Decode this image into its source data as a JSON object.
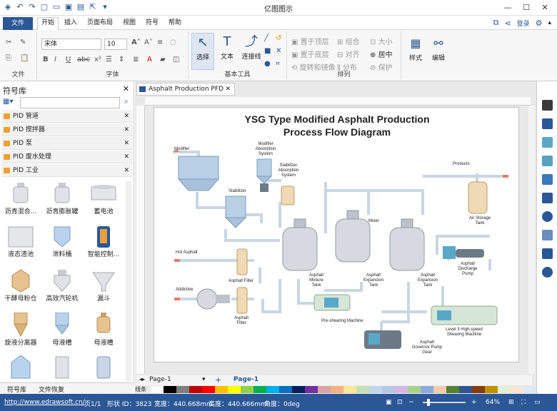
{
  "app": {
    "title": "亿图图示"
  },
  "menu": {
    "file": "文件",
    "tabs": [
      "开始",
      "插入",
      "页面布局",
      "视图",
      "符号",
      "帮助"
    ],
    "login": "登录"
  },
  "ribbon": {
    "font_name": "宋体",
    "font_size": "10",
    "groups": {
      "file": "文件",
      "font": "字体",
      "tools": "基本工具",
      "arrange": "排列"
    },
    "tools": {
      "select": "选择",
      "text": "文本",
      "connector": "连接线"
    },
    "arrange": [
      "置于顶层",
      "置于底层",
      "旋转和镜像",
      "组合",
      "对齐",
      "分布",
      "大小",
      "居中",
      "保护"
    ],
    "style": "样式",
    "edit": "编辑"
  },
  "library": {
    "title": "符号库",
    "categories": [
      "PID 管道",
      "PID 搅拌器",
      "PID 泵",
      "PID 废水处理",
      "PID 工业"
    ],
    "symbols": [
      "沥青混合...",
      "沥青膨胀罐",
      "蓄电池",
      "液态渣池",
      "泄料桶",
      "智能控制...",
      "干酵母粉仓",
      "高效汽轮机",
      "漏斗",
      "旋液分离器",
      "母液槽",
      "母液槽"
    ],
    "bottom_tabs": [
      "符号库",
      "文件恢复"
    ]
  },
  "document": {
    "tab": "Asphalt Production PFD",
    "title_line1": "YSG Type Modified Asphalt Production",
    "title_line2": "Process Flow Diagram",
    "labels": {
      "modifier": "Modifier",
      "modifier_abs": "Modifier Absorption System",
      "stabilizer_abs": "Stabilizer Absorption System",
      "stabilizer": "Stabilizer",
      "products": "Products",
      "mixer": "Mixer",
      "air_storage": "Air Storage Tank",
      "hot_asphalt": "Hot Asphalt",
      "asphalt_filter_1": "Asphalt Filter",
      "addictive": "Addictive",
      "asphalt_filter_2": "Asphalt Filter",
      "mixture_tank": "Asphalt Mixture Tank",
      "expansion_tank_1": "Asphalt Expansion Tank",
      "expansion_tank_2": "Asphalt Expansion Tank",
      "discharge_pump": "Asphalt Discharge Pump",
      "preshearing": "Pre-shearing Machine",
      "high_speed": "Level 3 High-speed Shearing Machine",
      "governor": "Asphalt Governor Pump Gear"
    }
  },
  "pagebar": {
    "page_select": "Page-1",
    "page_tab": "Page-1",
    "line_color_label": "线条"
  },
  "status": {
    "url": "http://www.edrawsoft.cn/",
    "page": "页1/1",
    "shape_id": "形状 ID：3823",
    "width": "宽度：440.668mm",
    "height": "高度：440.666mm",
    "angle": "角度：0deg",
    "zoom": "64%"
  },
  "colors": {
    "accent": "#2b5797",
    "ribbon_bg": "#f7f7f7",
    "canvas_bg": "#e9e9e9"
  }
}
